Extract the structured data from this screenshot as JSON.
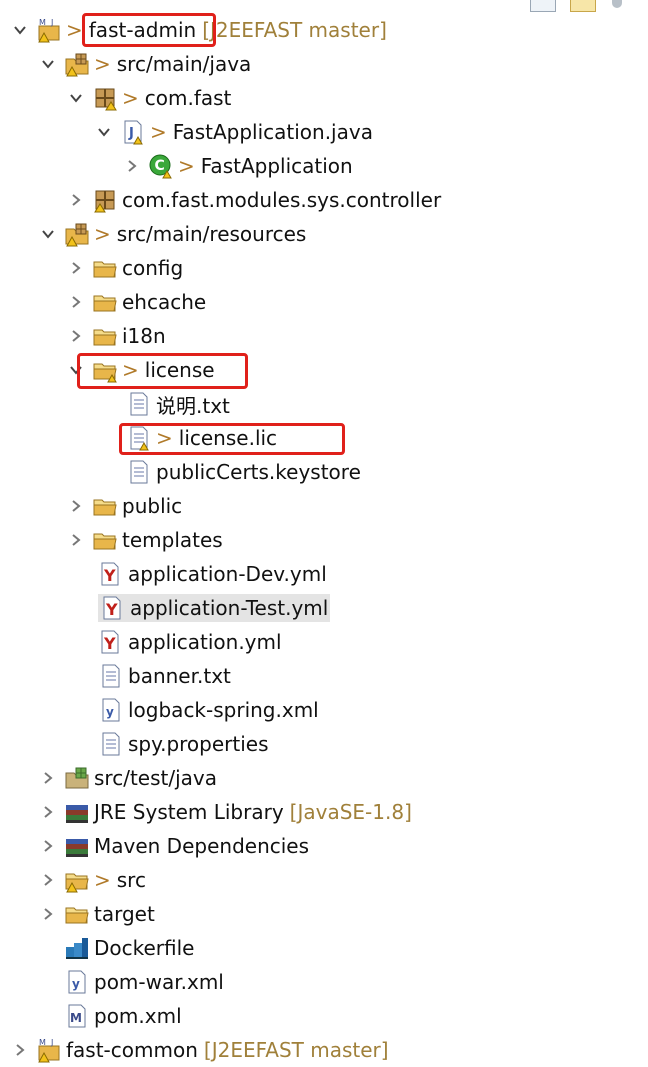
{
  "colors": {
    "highlight_box": "#e0201a",
    "decoration": "#a0803a",
    "folder": "#e8b64a",
    "package": "#c79a55"
  },
  "toolbar": {
    "buttons": [
      "collapse-all",
      "link-with-editor",
      "view-menu"
    ]
  },
  "tree": [
    {
      "label": "fast-admin",
      "decoration": "[J2EEFAST master]",
      "prefix": ">",
      "icon": "maven-project-icon",
      "expanded": true
    },
    {
      "label": "src/main/java",
      "prefix": ">",
      "icon": "source-folder-icon",
      "expanded": true
    },
    {
      "label": "com.fast",
      "prefix": ">",
      "icon": "package-icon",
      "expanded": true
    },
    {
      "label": "FastApplication.java",
      "prefix": ">",
      "icon": "java-file-icon",
      "expanded": true
    },
    {
      "label": "FastApplication",
      "prefix": ">",
      "icon": "class-icon",
      "expanded": false
    },
    {
      "label": "com.fast.modules.sys.controller",
      "prefix": "",
      "icon": "package-icon",
      "expanded": false
    },
    {
      "label": "src/main/resources",
      "prefix": ">",
      "icon": "source-folder-icon",
      "expanded": true
    },
    {
      "label": "config",
      "prefix": "",
      "icon": "folder-icon",
      "expanded": false
    },
    {
      "label": "ehcache",
      "prefix": "",
      "icon": "folder-icon",
      "expanded": false
    },
    {
      "label": "i18n",
      "prefix": "",
      "icon": "folder-icon",
      "expanded": false
    },
    {
      "label": "license",
      "prefix": ">",
      "icon": "folder-icon",
      "expanded": true
    },
    {
      "label": "说明.txt",
      "prefix": "",
      "icon": "text-file-icon"
    },
    {
      "label": "license.lic",
      "prefix": ">",
      "icon": "text-file-icon"
    },
    {
      "label": "publicCerts.keystore",
      "prefix": "",
      "icon": "text-file-icon"
    },
    {
      "label": "public",
      "prefix": "",
      "icon": "folder-icon",
      "expanded": false
    },
    {
      "label": "templates",
      "prefix": "",
      "icon": "folder-icon",
      "expanded": false
    },
    {
      "label": "application-Dev.yml",
      "prefix": "",
      "icon": "yaml-file-icon"
    },
    {
      "label": "application-Test.yml",
      "prefix": "",
      "icon": "yaml-file-icon",
      "selected": true
    },
    {
      "label": "application.yml",
      "prefix": "",
      "icon": "yaml-file-icon"
    },
    {
      "label": "banner.txt",
      "prefix": "",
      "icon": "text-file-icon"
    },
    {
      "label": "logback-spring.xml",
      "prefix": "",
      "icon": "xml-file-icon"
    },
    {
      "label": "spy.properties",
      "prefix": "",
      "icon": "text-file-icon"
    },
    {
      "label": "src/test/java",
      "prefix": "",
      "icon": "source-folder-icon",
      "expanded": false
    },
    {
      "label": "JRE System Library",
      "decoration": "[JavaSE-1.8]",
      "prefix": "",
      "icon": "library-icon",
      "expanded": false
    },
    {
      "label": "Maven Dependencies",
      "prefix": "",
      "icon": "library-icon",
      "expanded": false
    },
    {
      "label": "src",
      "prefix": ">",
      "icon": "folder-warning-icon",
      "expanded": false
    },
    {
      "label": "target",
      "prefix": "",
      "icon": "folder-icon",
      "expanded": false
    },
    {
      "label": "Dockerfile",
      "prefix": "",
      "icon": "docker-file-icon"
    },
    {
      "label": "pom-war.xml",
      "prefix": "",
      "icon": "xml-file-icon"
    },
    {
      "label": "pom.xml",
      "prefix": "",
      "icon": "maven-pom-icon"
    },
    {
      "label": "fast-common",
      "decoration": "[J2EEFAST master]",
      "prefix": "",
      "icon": "maven-project-icon",
      "expanded": false
    }
  ]
}
